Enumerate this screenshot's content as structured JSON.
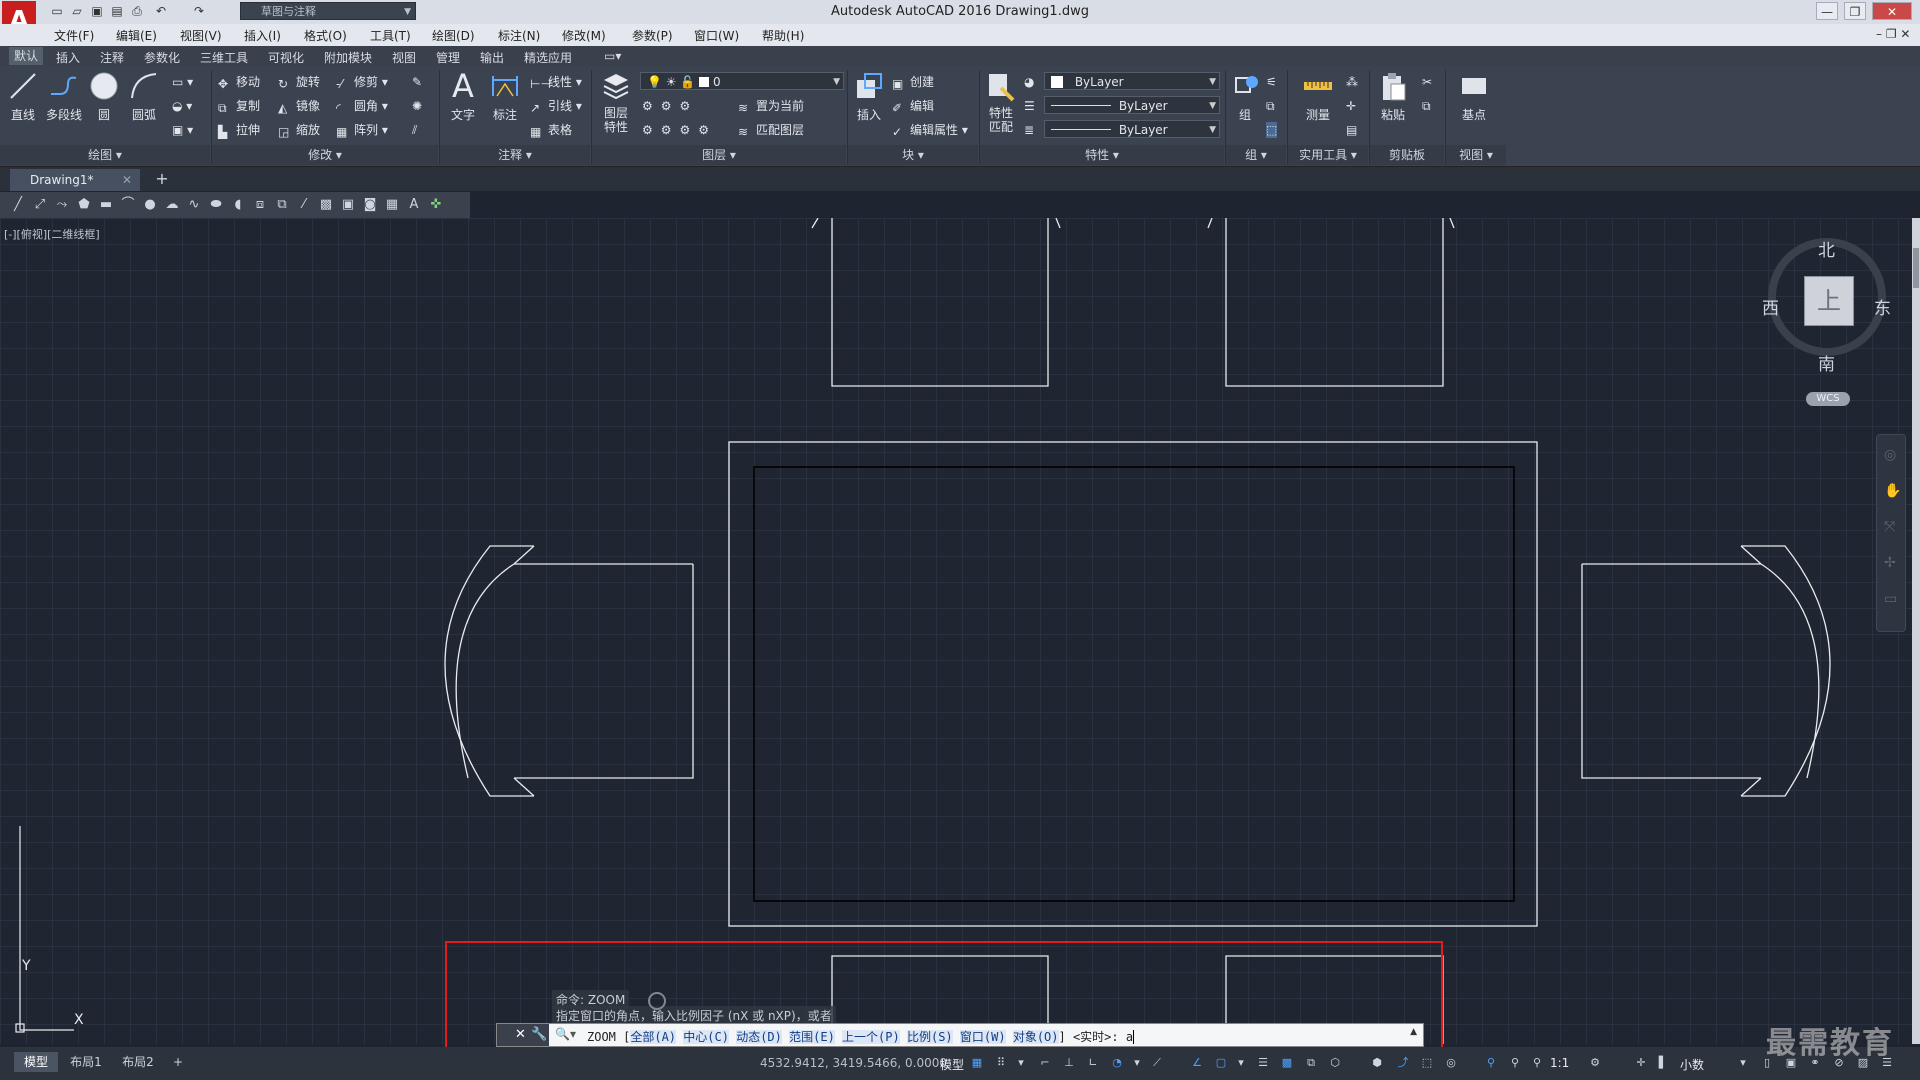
{
  "titlebar": {
    "title": "Autodesk AutoCAD 2016    Drawing1.dwg",
    "workspace": "草图与注释",
    "app_logo": "A"
  },
  "menu": [
    "文件(F)",
    "编辑(E)",
    "视图(V)",
    "插入(I)",
    "格式(O)",
    "工具(T)",
    "绘图(D)",
    "标注(N)",
    "修改(M)",
    "参数(P)",
    "窗口(W)",
    "帮助(H)"
  ],
  "ribbon_tabs": [
    "默认",
    "插入",
    "注释",
    "参数化",
    "三维工具",
    "可视化",
    "附加模块",
    "视图",
    "管理",
    "输出",
    "精选应用"
  ],
  "ribbon": {
    "draw": {
      "line": "直线",
      "polyline": "多段线",
      "circle": "圆",
      "arc": "圆弧",
      "title": "绘图 ▾"
    },
    "modify": {
      "move": "移动",
      "rotate": "旋转",
      "trim": "修剪",
      "copy": "复制",
      "mirror": "镜像",
      "fillet": "圆角",
      "stretch": "拉伸",
      "scale": "缩放",
      "array": "阵列",
      "title": "修改 ▾"
    },
    "annotation": {
      "text": "文字",
      "dimension": "标注",
      "linear": "线性",
      "leader": "引线",
      "table": "表格",
      "title": "注释 ▾"
    },
    "layers": {
      "layer_props": "图层\n特性",
      "current_layer": "0",
      "set_current": "置为当前",
      "match_layer": "匹配图层",
      "title": "图层 ▾"
    },
    "block": {
      "insert": "插入",
      "create": "创建",
      "edit": "编辑",
      "edit_attr": "编辑属性",
      "title": "块 ▾"
    },
    "properties": {
      "match": "特性\n匹配",
      "color": "ByLayer",
      "linetype": "ByLayer",
      "lineweight": "ByLayer",
      "title": "特性 ▾"
    },
    "groups": {
      "group": "组",
      "title": "组 ▾"
    },
    "utilities": {
      "measure": "测量",
      "title": "实用工具 ▾"
    },
    "clipboard": {
      "paste": "粘贴",
      "title": "剪贴板"
    },
    "view": {
      "base": "基点",
      "title": "视图 ▾"
    }
  },
  "file_tab": {
    "name": "Drawing1*"
  },
  "viewport": {
    "label": "[-][俯视][二维线框]"
  },
  "viewcube": {
    "north": "北",
    "south": "南",
    "east": "东",
    "west": "西",
    "top": "上",
    "wcs": "WCS"
  },
  "ucs": {
    "x": "X",
    "y": "Y"
  },
  "command": {
    "history1": "命令: ZOOM",
    "history2": "指定窗口的角点，输入比例因子 (nX 或 nXP)，或者",
    "prefix": "ZOOM [",
    "opt_all": "全部(A)",
    "opt_center": "中心(C)",
    "opt_dynamic": "动态(D)",
    "opt_extents": "范围(E)",
    "opt_previous": "上一个(P)",
    "opt_scale": "比例(S)",
    "opt_window": "窗口(W)",
    "opt_object": "对象(O)",
    "suffix": "] <实时>: ",
    "input": "a"
  },
  "status": {
    "layouts": [
      "模型",
      "布局1",
      "布局2"
    ],
    "coords": "4532.9412, 3419.5466, 0.0000",
    "model": "模型",
    "scale": "1:1",
    "units": "小数"
  },
  "watermark": "最需教育",
  "colors": {
    "highlight": "#e21b1b",
    "viewport_bg": "#1f2531"
  }
}
